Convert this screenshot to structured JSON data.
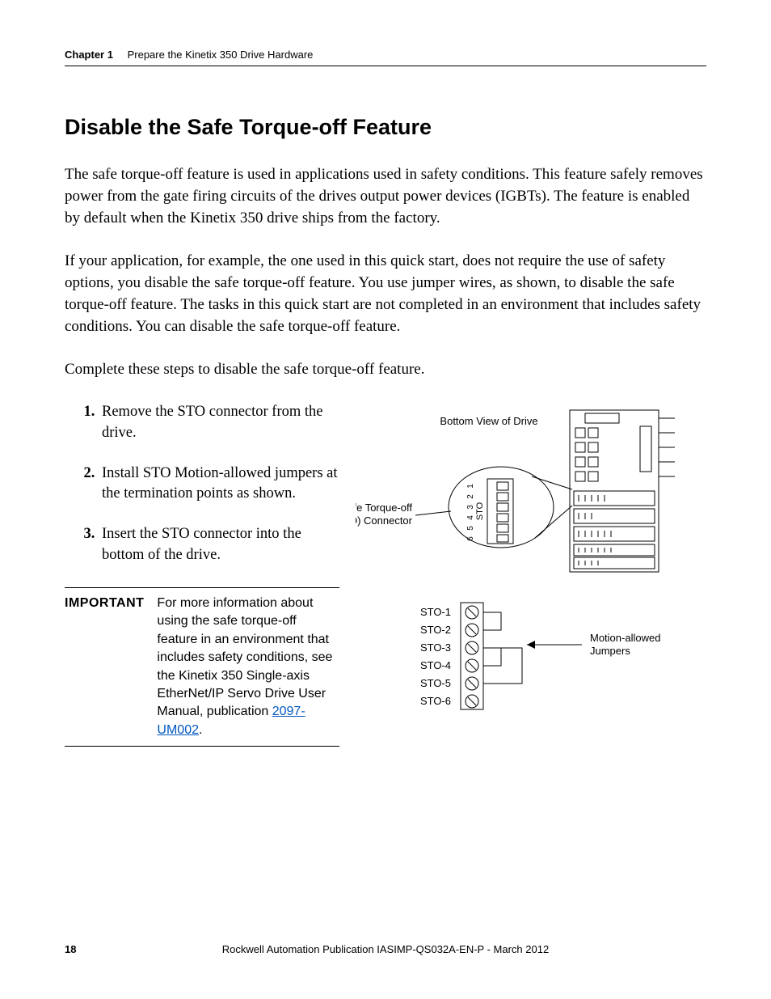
{
  "header": {
    "chapter_label": "Chapter 1",
    "chapter_title": "Prepare the Kinetix 350 Drive Hardware"
  },
  "section": {
    "heading": "Disable the Safe Torque-off Feature",
    "para1": "The safe torque-off feature is used in applications used in safety conditions. This feature safely removes power from the gate firing circuits of the drives output power devices (IGBTs). The feature is enabled by default when the Kinetix 350 drive ships from the factory.",
    "para2": "If your application, for example, the one used in this quick start, does not require the use of safety options, you disable the safe torque-off feature. You use jumper wires, as shown, to disable the safe torque-off feature. The tasks in this quick start are not completed in an environment that includes safety conditions. You can disable the safe torque-off feature.",
    "para3": "Complete these steps to disable the safe torque-off feature.",
    "steps": {
      "s1": "Remove the STO connector from the drive.",
      "s2": "Install STO Motion-allowed jumpers at the termination points as shown.",
      "s3": "Insert the STO connector into the bottom of the drive."
    }
  },
  "important": {
    "label": "IMPORTANT",
    "text_before_link": "For more information about using the safe torque-off feature in an environment that includes safety conditions, see the Kinetix 350 Single-axis EtherNet/IP Servo Drive User Manual, publication ",
    "link_text": "2097-UM002",
    "text_after_link": "."
  },
  "diagram": {
    "top_label": "Bottom View of Drive",
    "sto_label_line1": "Safe Torque-off",
    "sto_label_line2": "(STO) Connector",
    "sto_vertical": "STO",
    "connector_pins": [
      "1",
      "2",
      "3",
      "4",
      "5",
      "6"
    ],
    "terminal_labels": [
      "STO-1",
      "STO-2",
      "STO-3",
      "STO-4",
      "STO-5",
      "STO-6"
    ],
    "jumper_label_line1": "Motion-allowed",
    "jumper_label_line2": "Jumpers"
  },
  "footer": {
    "page": "18",
    "pub": "Rockwell Automation Publication IASIMP-QS032A-EN-P - March 2012"
  }
}
